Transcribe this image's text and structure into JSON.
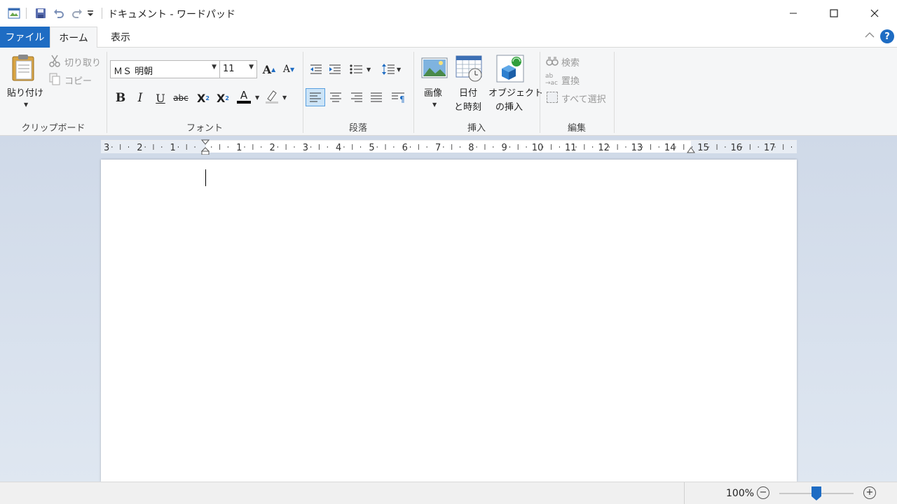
{
  "window": {
    "title": "ドキュメント - ワードパッド",
    "minimize_icon": "minimize-icon",
    "maximize_icon": "maximize-icon",
    "close_icon": "close-icon"
  },
  "quick_access": {
    "icons": [
      "app-icon",
      "save-icon",
      "undo-icon",
      "redo-icon",
      "customize-dropdown-icon"
    ]
  },
  "tabs": [
    {
      "label": "ファイル",
      "active": false
    },
    {
      "label": "ホーム",
      "active": true
    },
    {
      "label": "表示",
      "active": false
    }
  ],
  "ribbon": {
    "clipboard": {
      "paste_label": "貼り付け",
      "cut_label": "切り取り",
      "copy_label": "コピー",
      "group_label": "クリップボード"
    },
    "font": {
      "font_name": "ＭＳ 明朝",
      "font_size": "11",
      "group_label": "フォント",
      "font_color": "#000000"
    },
    "paragraph": {
      "group_label": "段落"
    },
    "insert": {
      "picture_label": "画像",
      "datetime_line1": "日付",
      "datetime_line2": "と時刻",
      "object_line1": "オブジェクト",
      "object_line2": "の挿入",
      "group_label": "挿入"
    },
    "editing": {
      "find_label": "検索",
      "replace_label": "置換",
      "select_all_label": "すべて選択",
      "group_label": "編集"
    }
  },
  "ruler": {
    "numbers": [
      "3",
      "2",
      "1",
      "1",
      "2",
      "3",
      "4",
      "5",
      "6",
      "7",
      "8",
      "9",
      "10",
      "11",
      "12",
      "13",
      "14",
      "15",
      "16",
      "17"
    ]
  },
  "status": {
    "zoom": "100%"
  },
  "colors": {
    "accent": "#1e6cc3",
    "ribbon_bg": "#f5f6f7",
    "canvas_bg": "#d6dfeb"
  }
}
